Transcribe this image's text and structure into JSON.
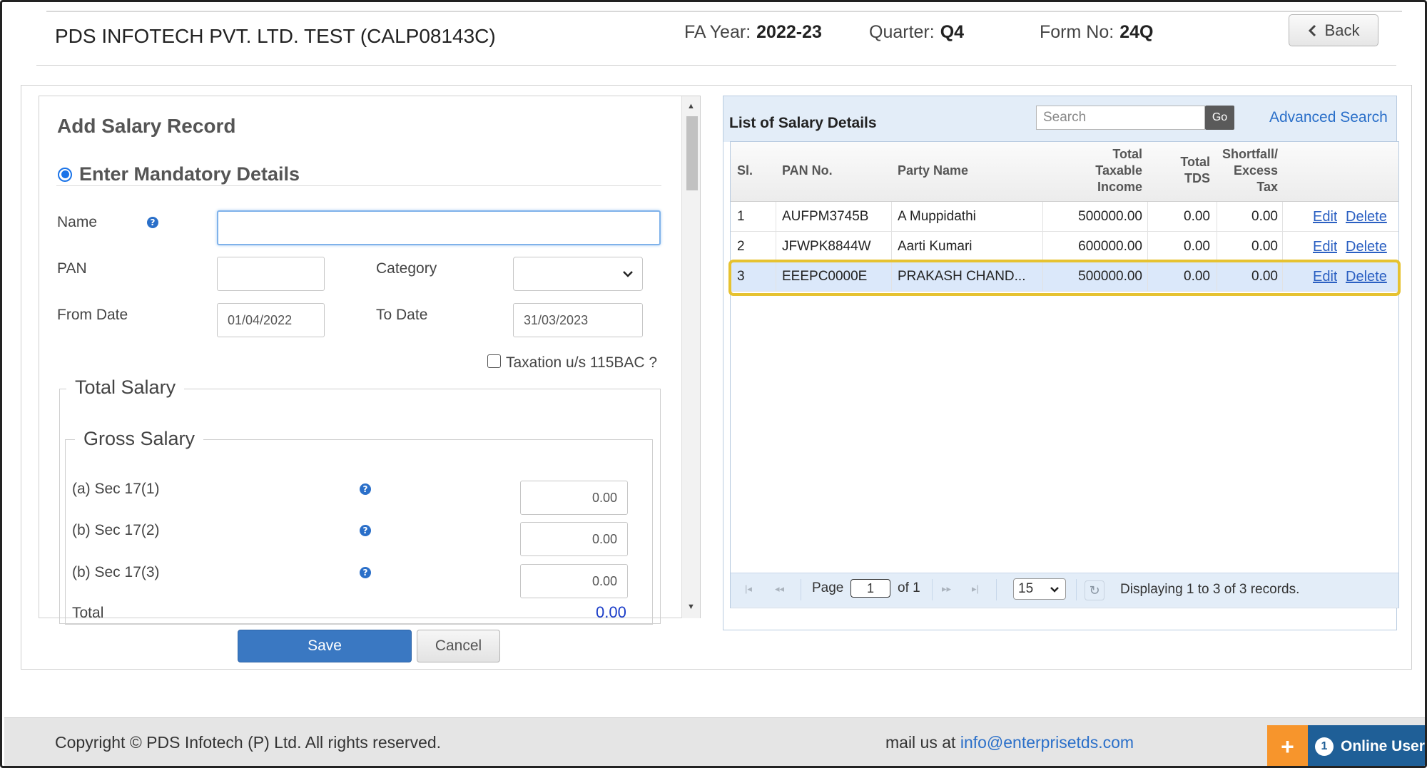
{
  "header": {
    "company": "PDS INFOTECH PVT. LTD. TEST (CALP08143C)",
    "fa_year_label": "FA Year:",
    "fa_year": "2022-23",
    "quarter_label": "Quarter:",
    "quarter": "Q4",
    "form_no_label": "Form No:",
    "form_no": "24Q",
    "back_label": "Back"
  },
  "form": {
    "title": "Add Salary Record",
    "section": "Enter Mandatory Details",
    "name_label": "Name",
    "name_value": "",
    "pan_label": "PAN",
    "pan_value": "",
    "category_label": "Category",
    "category_value": "",
    "from_date_label": "From Date",
    "from_date": "01/04/2022",
    "to_date_label": "To Date",
    "to_date": "31/03/2023",
    "taxation_label": "Taxation u/s 115BAC ?",
    "total_salary_legend": "Total Salary",
    "gross_salary_legend": "Gross Salary",
    "sec_a_label": "(a) Sec 17(1)",
    "sec_a_value": "0.00",
    "sec_b_label": "(b) Sec 17(2)",
    "sec_b_value": "0.00",
    "sec_c_label": "(b) Sec 17(3)",
    "sec_c_value": "0.00",
    "total_label": "Total",
    "total_value": "0.00",
    "save_label": "Save",
    "cancel_label": "Cancel"
  },
  "grid": {
    "title": "List of Salary Details",
    "search_placeholder": "Search",
    "go_label": "Go",
    "advanced_search": "Advanced Search",
    "columns": {
      "sl": "Sl.",
      "pan": "PAN No.",
      "party": "Party Name",
      "income_1": "Total",
      "income_2": "Taxable",
      "income_3": "Income",
      "tds_1": "Total",
      "tds_2": "TDS",
      "short_1": "Shortfall/",
      "short_2": "Excess",
      "short_3": "Tax"
    },
    "rows": [
      {
        "sl": "1",
        "pan": "AUFPM3745B",
        "party": "A Muppidathi",
        "income": "500000.00",
        "tds": "0.00",
        "short": "0.00",
        "edit": "Edit",
        "delete": "Delete"
      },
      {
        "sl": "2",
        "pan": "JFWPK8844W",
        "party": "Aarti Kumari",
        "income": "600000.00",
        "tds": "0.00",
        "short": "0.00",
        "edit": "Edit",
        "delete": "Delete"
      },
      {
        "sl": "3",
        "pan": "EEEPC0000E",
        "party": "PRAKASH CHAND...",
        "income": "500000.00",
        "tds": "0.00",
        "short": "0.00",
        "edit": "Edit",
        "delete": "Delete"
      }
    ],
    "pager": {
      "page_label": "Page",
      "page": "1",
      "of_label": "of 1",
      "page_size": "15",
      "display_text": "Displaying 1 to 3 of 3 records."
    }
  },
  "footer": {
    "copyright": "Copyright © PDS Infotech (P) Ltd. All rights reserved.",
    "mail_prefix": "mail us at",
    "mail": "info@enterprisetds.com",
    "plus_label": "+",
    "online_count": "1",
    "online_label": "Online Users"
  }
}
